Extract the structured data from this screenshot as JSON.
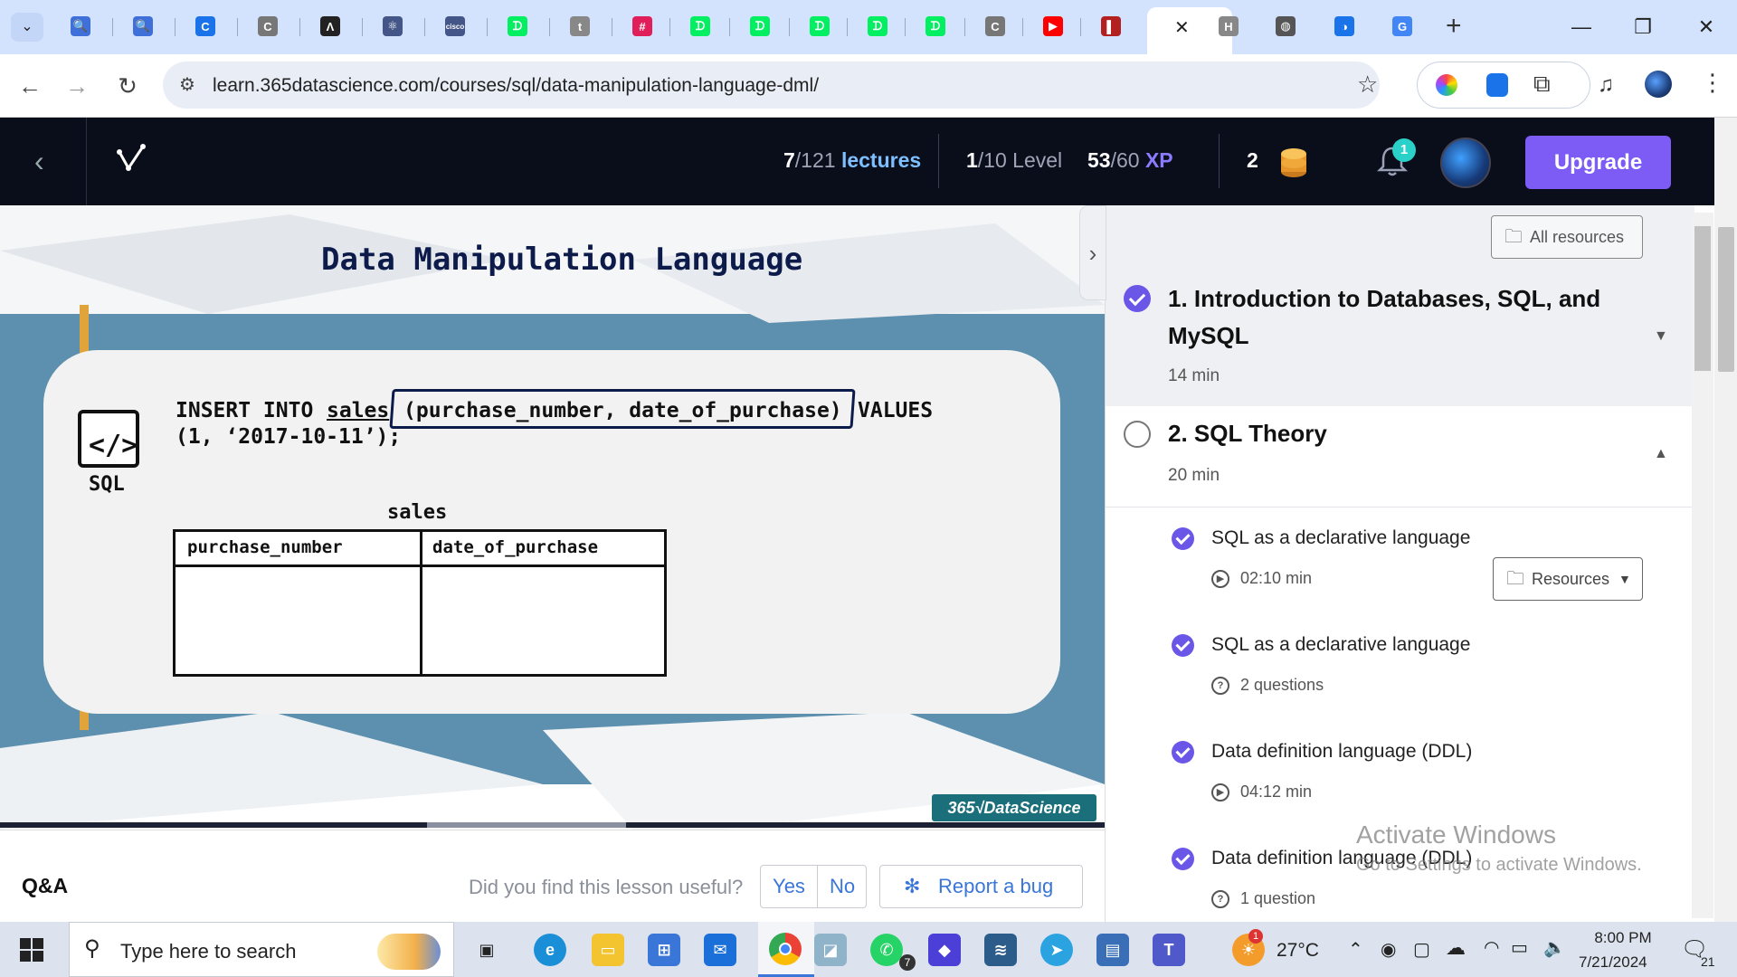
{
  "browser": {
    "url": "learn.365datascience.com/courses/sql/data-manipulation-language-dml/",
    "tab_close": "✕",
    "new_tab": "+",
    "tab_icons": [
      {
        "name": "search-tab-icon",
        "glyph": "🔍",
        "color": "#3f6fd8"
      },
      {
        "name": "search-tab-icon",
        "glyph": "🔍",
        "color": "#3f6fd8"
      },
      {
        "name": "c-tab-icon",
        "glyph": "C",
        "color": "#1a73e8"
      },
      {
        "name": "c-tab-icon",
        "glyph": "C",
        "color": "#777777"
      },
      {
        "name": "caret-tab-icon",
        "glyph": "Λ",
        "color": "#222222"
      },
      {
        "name": "pattern-tab-icon",
        "glyph": "⚛",
        "color": "#445588"
      },
      {
        "name": "cisco-tab-icon",
        "glyph": "cisco",
        "color": "#445588"
      },
      {
        "name": "datacamp-tab-icon",
        "glyph": "ᗪ",
        "color": "#03ef62"
      },
      {
        "name": "t-tab-icon",
        "glyph": "t",
        "color": "#888888"
      },
      {
        "name": "slack-tab-icon",
        "glyph": "#",
        "color": "#e01e5a"
      },
      {
        "name": "datacamp-tab-icon",
        "glyph": "ᗪ",
        "color": "#03ef62"
      },
      {
        "name": "datacamp-tab-icon",
        "glyph": "ᗪ",
        "color": "#03ef62"
      },
      {
        "name": "datacamp-tab-icon",
        "glyph": "ᗪ",
        "color": "#03ef62"
      },
      {
        "name": "datacamp-tab-icon",
        "glyph": "ᗪ",
        "color": "#03ef62"
      },
      {
        "name": "datacamp-tab-icon",
        "glyph": "ᗪ",
        "color": "#03ef62"
      },
      {
        "name": "c-tab-icon",
        "glyph": "C",
        "color": "#777777"
      },
      {
        "name": "youtube-tab-icon",
        "glyph": "▶",
        "color": "#ff0000"
      },
      {
        "name": "book-tab-icon",
        "glyph": "▌",
        "color": "#b32020"
      }
    ],
    "tab_icons_right": [
      {
        "name": "h-tab-icon",
        "glyph": "H",
        "color": "#888888"
      },
      {
        "name": "globe-tab-icon",
        "glyph": "◍",
        "color": "#555555"
      },
      {
        "name": "edge-tab-icon",
        "glyph": "◑",
        "color": "#1a73e8"
      },
      {
        "name": "google-tab-icon",
        "glyph": "G",
        "color": "#4285f4"
      }
    ]
  },
  "header": {
    "lectures_done": "7",
    "lectures_total": "/121",
    "lectures_label": "lectures",
    "level_current": "1",
    "level_total": "/10",
    "level_label": "Level",
    "xp_current": "53",
    "xp_total": "/60",
    "xp_label": "XP",
    "coins": "2",
    "notifications": "1",
    "upgrade_label": "Upgrade"
  },
  "slide": {
    "title": "Data Manipulation Language",
    "sql_logo": "</>",
    "sql_label": "SQL",
    "code_part1": "INSERT INTO",
    "code_table": "sales",
    "code_columns": "(purchase_number, date_of_purchase)",
    "code_values_kw": "VALUES",
    "code_line2": "(1, ‘2017-10-11’);",
    "table_title": "sales",
    "table_headers": [
      "purchase_number",
      "date_of_purchase"
    ],
    "brand": "365√DataScience"
  },
  "video": {
    "progress": 0.5
  },
  "qa": {
    "label": "Q&A",
    "question": "Did you find this lesson useful?",
    "yes": "Yes",
    "no": "No",
    "report_bug": "Report a bug"
  },
  "sidebar": {
    "all_resources": "All resources",
    "sections": [
      {
        "title": "1. Introduction to Databases, SQL, and MySQL",
        "duration": "14 min",
        "completed": true,
        "expanded": false
      },
      {
        "title": "2. SQL Theory",
        "duration": "20 min",
        "completed": false,
        "expanded": true
      }
    ],
    "lessons": [
      {
        "title": "SQL as a declarative language",
        "meta": "02:10 min",
        "type": "video"
      },
      {
        "title": "SQL as a declarative language",
        "meta": "2 questions",
        "type": "quiz"
      },
      {
        "title": "Data definition language (DDL)",
        "meta": "04:12 min",
        "type": "video"
      },
      {
        "title": "Data definition language (DDL)",
        "meta": "1 question",
        "type": "quiz"
      }
    ],
    "resources_label": "Resources",
    "watermark_title": "Activate Windows",
    "watermark_sub": "Go to Settings to activate Windows."
  },
  "taskbar": {
    "search_placeholder": "Type here to search",
    "temperature": "27°C",
    "time": "8:00 PM",
    "date": "7/21/2024",
    "notification_count": "21",
    "whatsapp_badge": "7",
    "weather_badge": "1"
  }
}
